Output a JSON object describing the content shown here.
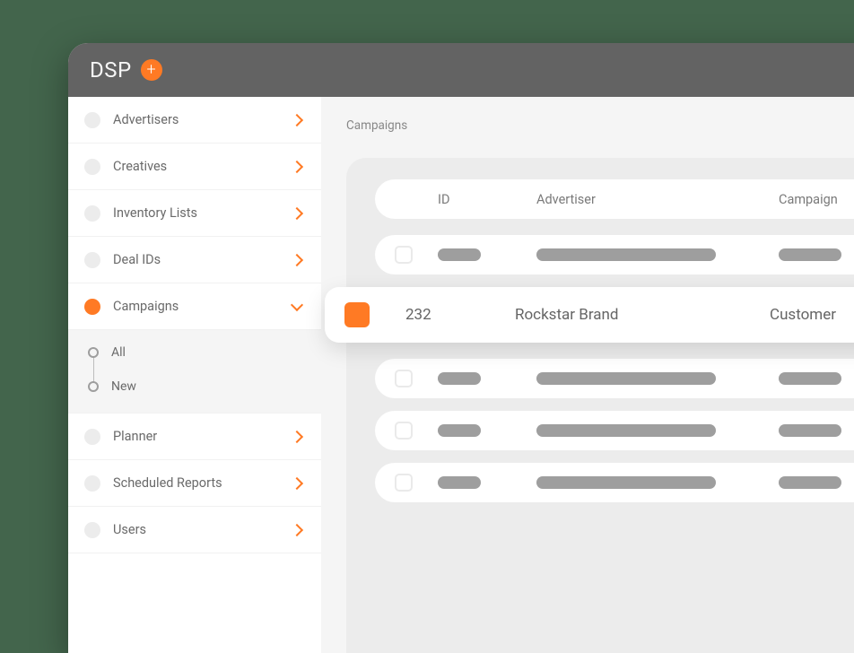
{
  "header": {
    "title": "DSP"
  },
  "sidebar": {
    "items": [
      {
        "label": "Advertisers",
        "active": false,
        "expanded": false
      },
      {
        "label": "Creatives",
        "active": false,
        "expanded": false
      },
      {
        "label": "Inventory Lists",
        "active": false,
        "expanded": false
      },
      {
        "label": "Deal IDs",
        "active": false,
        "expanded": false
      },
      {
        "label": "Campaigns",
        "active": true,
        "expanded": true
      },
      {
        "label": "Planner",
        "active": false,
        "expanded": false
      },
      {
        "label": "Scheduled Reports",
        "active": false,
        "expanded": false
      },
      {
        "label": "Users",
        "active": false,
        "expanded": false
      }
    ],
    "campaigns_subitems": [
      {
        "label": "All"
      },
      {
        "label": "New"
      }
    ]
  },
  "main": {
    "breadcrumb": "Campaigns",
    "columns": {
      "id": "ID",
      "advertiser": "Advertiser",
      "campaign": "Campaign"
    },
    "highlighted_row": {
      "id": "232",
      "advertiser": "Rockstar Brand",
      "campaign": "Customer"
    }
  },
  "colors": {
    "accent": "#ff7a24",
    "titlebar": "#636363",
    "bg": "#43654c"
  }
}
